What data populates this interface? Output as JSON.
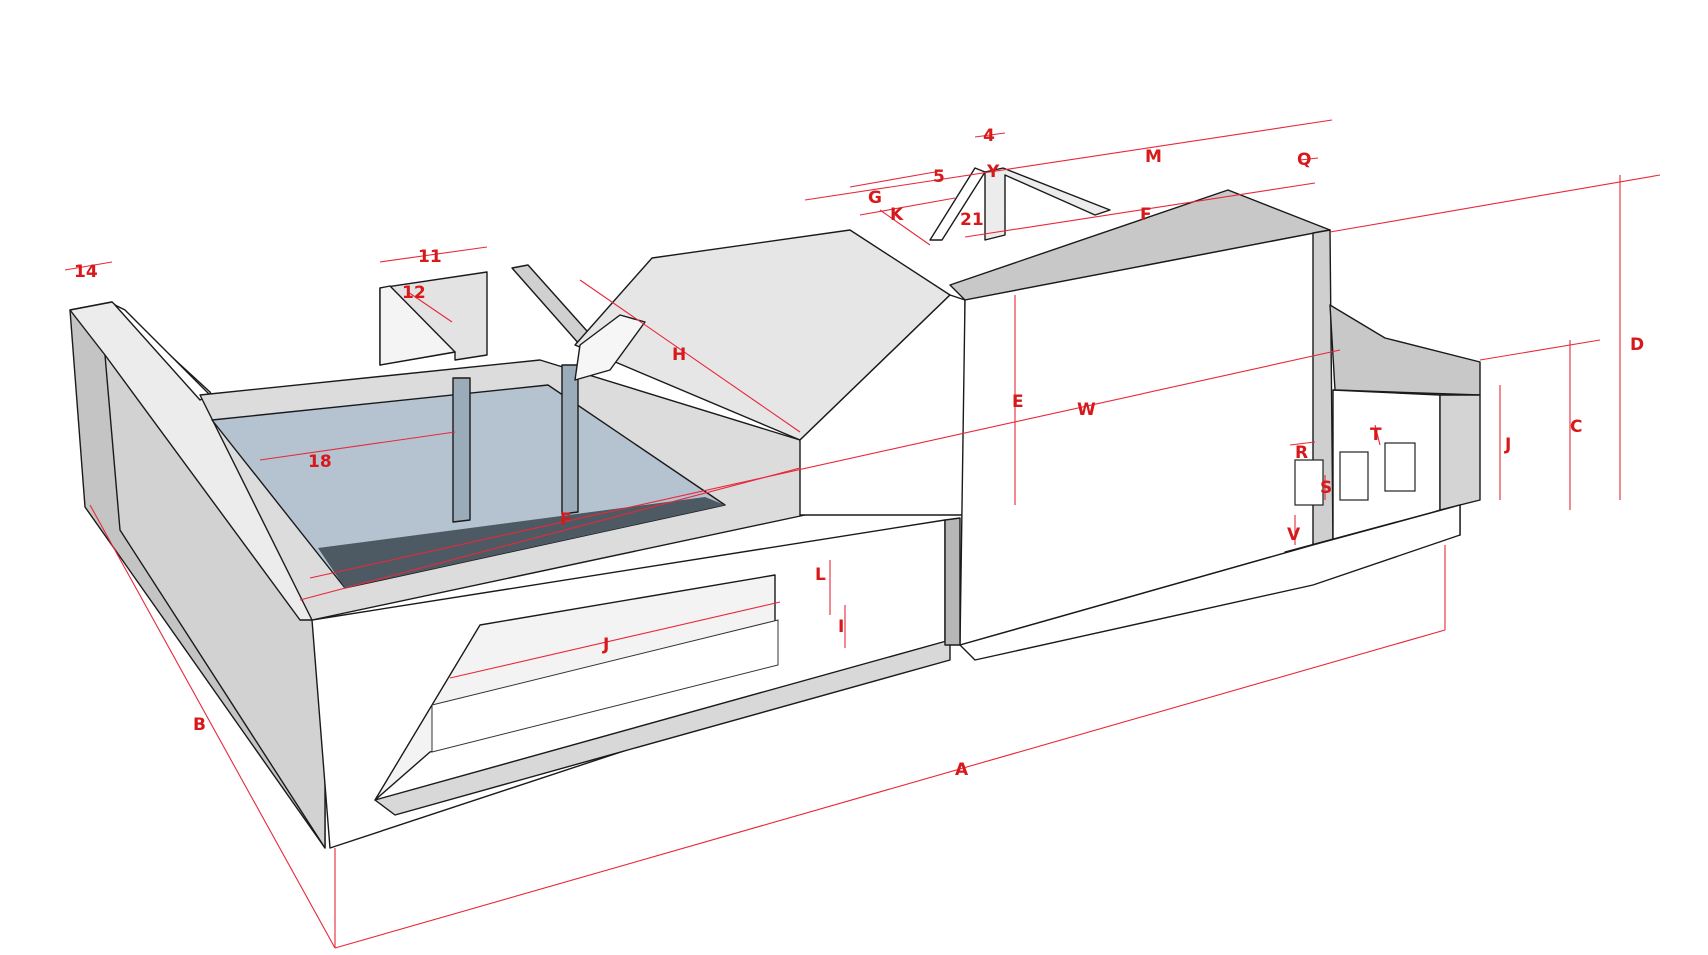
{
  "diagram": {
    "labels": {
      "A": "A",
      "B": "B",
      "C": "C",
      "D": "D",
      "E": "E",
      "F_top": "F",
      "F_side": "F",
      "G": "G",
      "H": "H",
      "I": "I",
      "J_side": "J",
      "J_annex": "J",
      "K": "K",
      "L": "L",
      "M": "M",
      "Q": "Q",
      "R": "R",
      "S": "S",
      "T": "T",
      "V": "V",
      "W": "W",
      "Y": "Y",
      "n4": "4",
      "n5": "5",
      "n11": "11",
      "n12": "12",
      "n14": "14",
      "n18": "18",
      "n21": "21"
    },
    "colors": {
      "dimension": "#e8283a",
      "label": "#d7191c",
      "edge": "#1a1a1a",
      "face_light": "#ffffff",
      "face_mid": "#e6e6e6",
      "face_dark": "#c8c8c8",
      "pool": "#b4c3cf"
    }
  }
}
